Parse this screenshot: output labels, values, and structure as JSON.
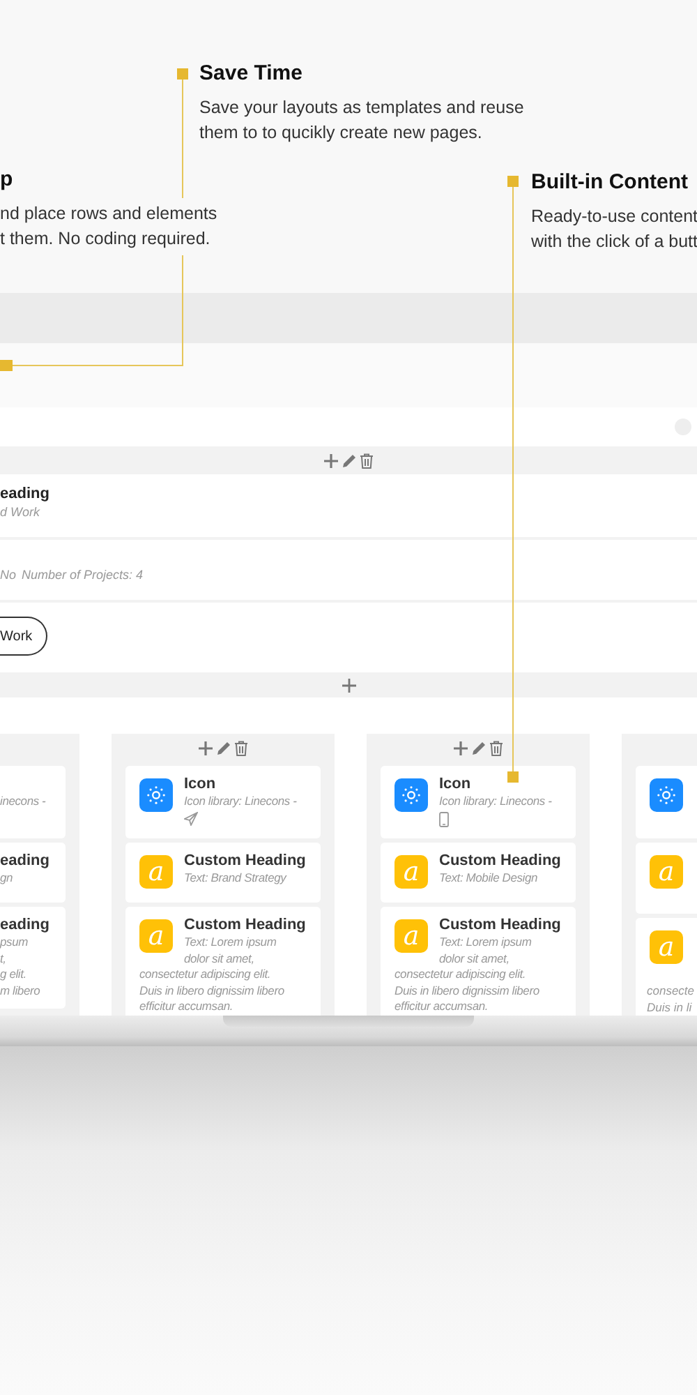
{
  "callouts": [
    {
      "title": "Save Time",
      "lines": [
        "Save your layouts as templates and reuse",
        "them to to qucikly create new pages."
      ]
    },
    {
      "title": "p",
      "lines": [
        "nd place rows and elements",
        "t them. No coding required."
      ]
    },
    {
      "title": "Built-in Content",
      "lines": [
        "Ready-to-use content",
        "with the click of a butt"
      ]
    }
  ],
  "editor": {
    "heading_row": {
      "title": "eading",
      "text": "d Work"
    },
    "meta_row": {
      "label": "No",
      "text": "Number of Projects: 4"
    },
    "button": "Work",
    "columns": [
      {
        "kind": "partial-left",
        "cards": [
          {
            "kind": "icon",
            "lines": [
              "inecons -"
            ]
          },
          {
            "kind": "heading",
            "title": "eading",
            "lines": [
              "gn"
            ]
          },
          {
            "kind": "heading",
            "title": "eading",
            "lines": [
              "psum",
              "t,",
              "g elit.",
              "m libero"
            ]
          }
        ]
      },
      {
        "kind": "full",
        "cards": [
          {
            "kind": "icon",
            "title": "Icon",
            "lines": [
              "Icon library: Linecons -"
            ]
          },
          {
            "kind": "heading",
            "badge": "a",
            "title": "Custom Heading",
            "lines": [
              "Text: Brand Strategy"
            ]
          },
          {
            "kind": "heading",
            "badge": "a",
            "title": "Custom Heading",
            "lines": [
              "Text: Lorem ipsum",
              "dolor sit amet,",
              "consectetur adipiscing elit.",
              "Duis in libero dignissim libero",
              "efficitur accumsan."
            ]
          }
        ]
      },
      {
        "kind": "full",
        "cards": [
          {
            "kind": "icon",
            "title": "Icon",
            "lines": [
              "Icon library: Linecons -"
            ]
          },
          {
            "kind": "heading",
            "badge": "a",
            "title": "Custom Heading",
            "lines": [
              "Text: Mobile Design"
            ]
          },
          {
            "kind": "heading",
            "badge": "a",
            "title": "Custom Heading",
            "lines": [
              "Text: Lorem ipsum",
              "dolor sit amet,",
              "consectetur adipiscing elit.",
              "Duis in libero dignissim libero",
              "efficitur accumsan."
            ]
          }
        ]
      },
      {
        "kind": "partial-right",
        "cards": [
          {
            "kind": "icon"
          },
          {
            "kind": "heading",
            "badge": "a"
          },
          {
            "kind": "heading",
            "badge": "a",
            "lines": [
              "consecte",
              "Duis in li"
            ]
          }
        ]
      }
    ]
  }
}
